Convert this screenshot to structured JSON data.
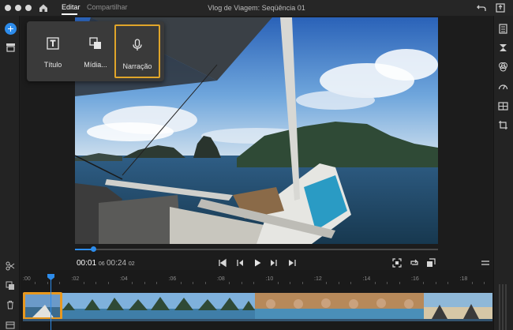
{
  "header": {
    "project_title": "Vlog de Viagem: Seqüência 01",
    "tabs": [
      {
        "label": "Editar",
        "active": true
      },
      {
        "label": "Compartilhar",
        "active": false
      }
    ]
  },
  "add_menu": {
    "items": [
      {
        "label": "Título",
        "icon": "title-icon"
      },
      {
        "label": "Mídia...",
        "icon": "media-icon"
      },
      {
        "label": "Narração",
        "icon": "microphone-icon",
        "selected": true
      }
    ]
  },
  "transport": {
    "current_time": "00:01",
    "current_frames": "06",
    "total_time": "00:24",
    "total_frames": "02",
    "progress": 0.05
  },
  "timeline": {
    "ruler_labels": [
      ":00",
      ":02",
      ":04",
      ":06",
      ":08",
      ":10",
      ":12",
      ":14",
      ":16",
      ":18"
    ]
  },
  "colors": {
    "accent": "#2d8ceb",
    "selection": "#e8981f"
  }
}
